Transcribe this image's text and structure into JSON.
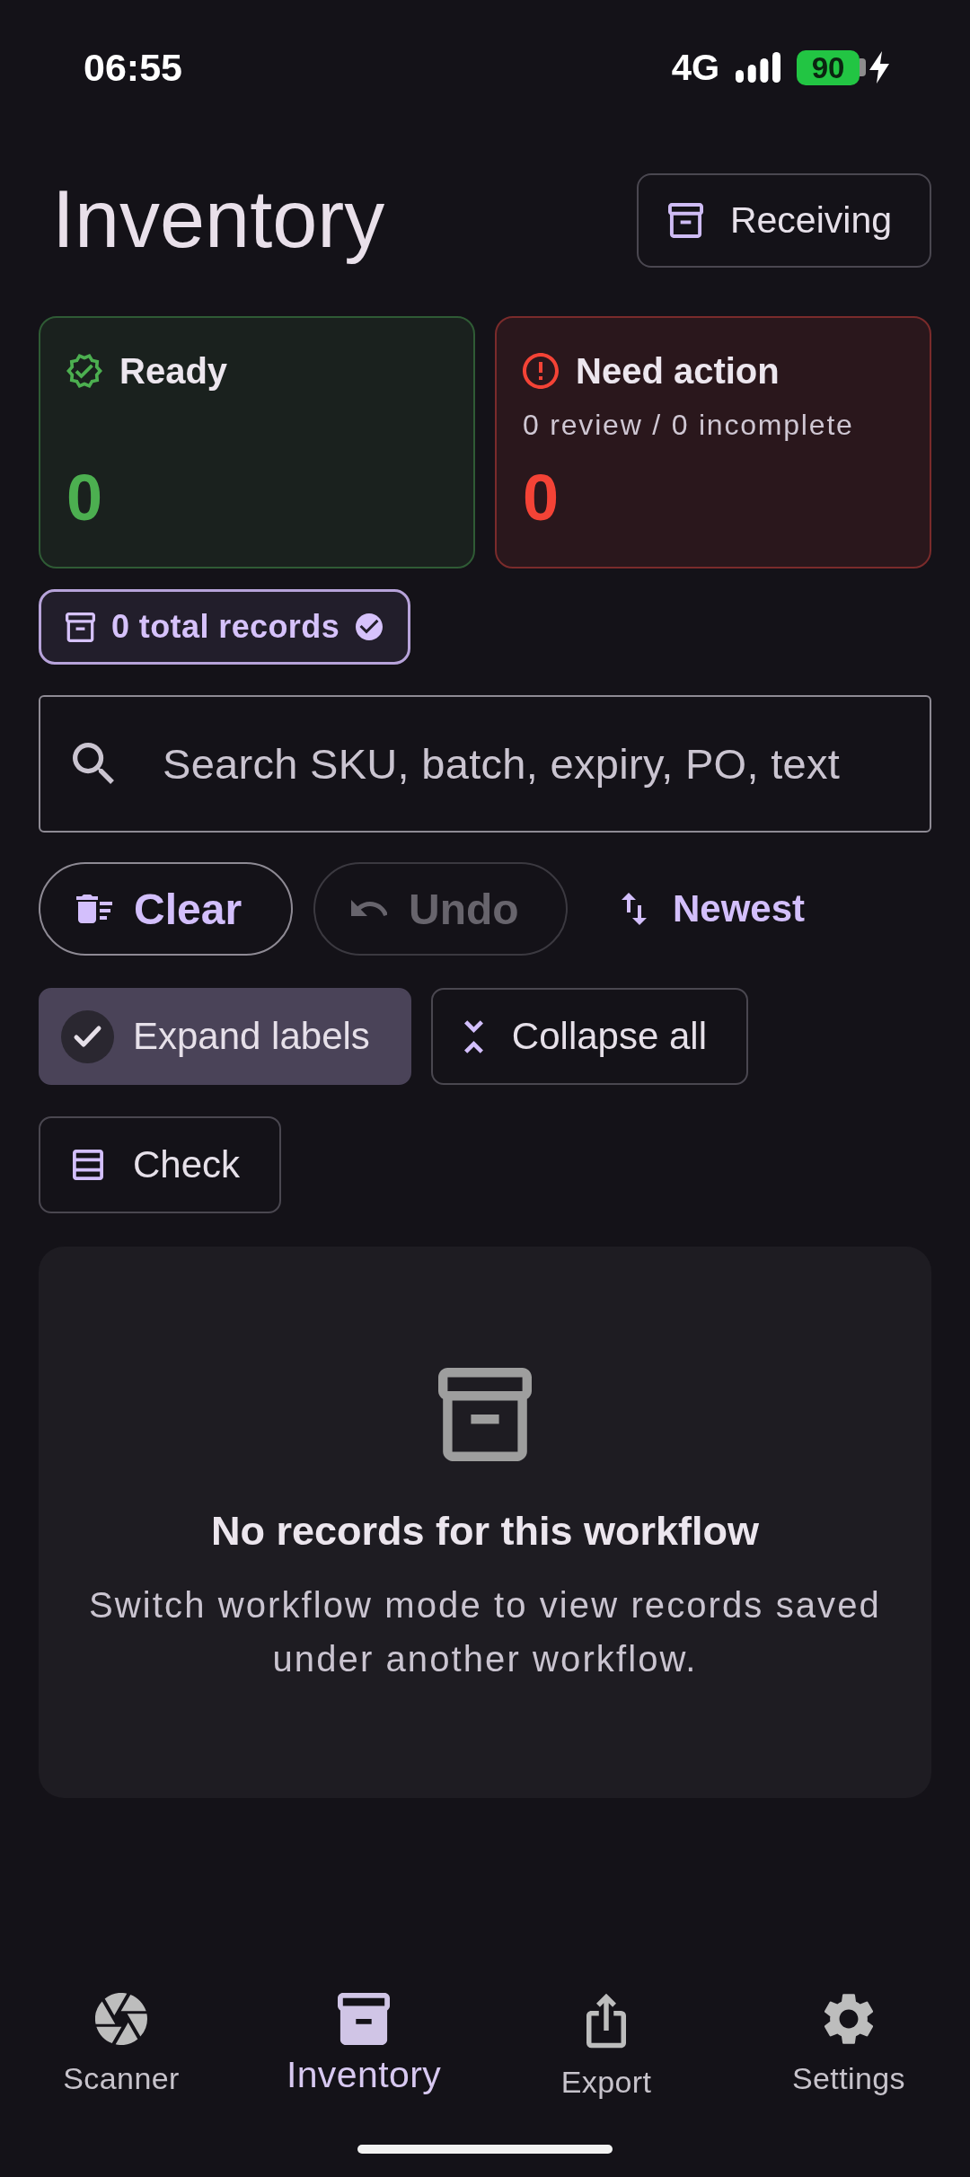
{
  "status_bar": {
    "time": "06:55",
    "network": "4G",
    "battery": "90"
  },
  "header": {
    "title": "Inventory",
    "mode_button": "Receiving"
  },
  "summary_cards": [
    {
      "kind": "ready",
      "title": "Ready",
      "count": "0"
    },
    {
      "kind": "attention",
      "title": "Need action",
      "subtitle": "0 review / 0 incomplete",
      "count": "0"
    }
  ],
  "total_chip": "0 total records",
  "search": {
    "placeholder": "Search SKU, batch, expiry, PO, text"
  },
  "actions": [
    {
      "kind": "outlined",
      "label": "Clear",
      "disabled": false
    },
    {
      "kind": "outlined",
      "label": "Undo",
      "disabled": true
    },
    {
      "kind": "text",
      "label": "Newest",
      "disabled": false
    }
  ],
  "view_chips": [
    {
      "label": "Expand labels",
      "selected": true
    },
    {
      "label": "Collapse all",
      "selected": false
    },
    {
      "label": "Check",
      "selected": false
    }
  ],
  "empty_state": {
    "title": "No records for this workflow",
    "message": "Switch workflow mode to view records saved under another workflow."
  },
  "bottom_nav": [
    {
      "label": "Scanner",
      "selected": false
    },
    {
      "label": "Inventory",
      "selected": true
    },
    {
      "label": "Export",
      "selected": false
    },
    {
      "label": "Settings",
      "selected": false
    }
  ]
}
